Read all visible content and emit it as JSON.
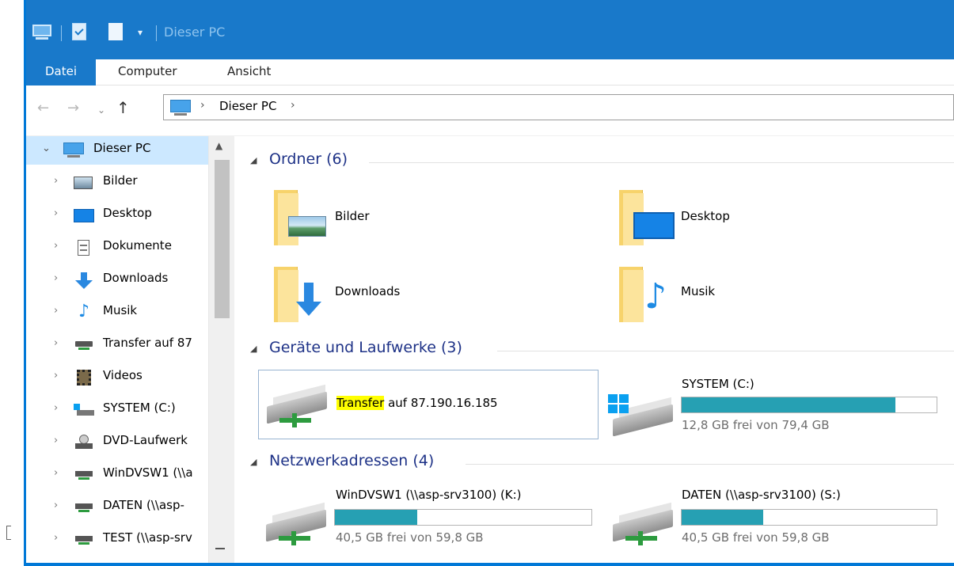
{
  "window": {
    "title": "Dieser PC",
    "accent": "#1979ca"
  },
  "ribbon": {
    "tabs": [
      "Datei",
      "Computer",
      "Ansicht"
    ]
  },
  "address": {
    "path": "Dieser PC",
    "separator": "›"
  },
  "nav": {
    "glyphs": {
      "back": "←",
      "forward": "→",
      "recent": "⌄",
      "up": "↑",
      "expand": "›",
      "collapse": "⌄"
    },
    "root": "Dieser PC",
    "items": [
      {
        "label": "Bilder",
        "icon": "pictures-icon"
      },
      {
        "label": "Desktop",
        "icon": "desktop-icon"
      },
      {
        "label": "Dokumente",
        "icon": "documents-icon"
      },
      {
        "label": "Downloads",
        "icon": "downloads-icon"
      },
      {
        "label": "Musik",
        "icon": "music-icon"
      },
      {
        "label": "Transfer auf 87",
        "icon": "network-drive-icon"
      },
      {
        "label": "Videos",
        "icon": "videos-icon"
      },
      {
        "label": "SYSTEM (C:)",
        "icon": "system-drive-icon"
      },
      {
        "label": "DVD-Laufwerk",
        "icon": "dvd-drive-icon"
      },
      {
        "label": "WinDVSW1 (\\\\a",
        "icon": "network-drive-icon"
      },
      {
        "label": "DATEN (\\\\asp-",
        "icon": "network-drive-icon"
      },
      {
        "label": "TEST (\\\\asp-srv",
        "icon": "network-drive-icon"
      }
    ]
  },
  "content": {
    "section_glyph": "◢",
    "folders_section": "Ordner (6)",
    "folders": [
      "Bilder",
      "Desktop",
      "Downloads",
      "Musik"
    ],
    "devices_section": "Geräte und Laufwerke (3)",
    "transfer": {
      "highlighted": "Transfer",
      "rest": " auf 87.190.16.185"
    },
    "system": {
      "name": "SYSTEM (C:)",
      "free": "12,8 GB frei von 79,4 GB",
      "used_fraction": 0.84
    },
    "network_section": "Netzwerkadressen (4)",
    "windvsw": {
      "name": "WinDVSW1 (\\\\asp-srv3100) (K:)",
      "free": "40,5 GB frei von 59,8 GB",
      "used_fraction": 0.32
    },
    "daten": {
      "name": "DATEN (\\\\asp-srv3100) (S:)",
      "free": "40,5 GB frei von 59,8 GB",
      "used_fraction": 0.32
    }
  }
}
